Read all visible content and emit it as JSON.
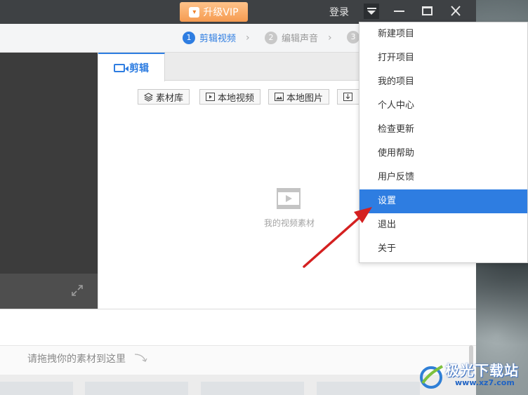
{
  "titlebar": {
    "vip_label": "升级VIP",
    "login_label": "登录"
  },
  "steps": [
    {
      "num": "1",
      "label": "剪辑视频",
      "active": true
    },
    {
      "num": "2",
      "label": "编辑声音",
      "active": false
    },
    {
      "num": "3",
      "label": "",
      "active": false
    }
  ],
  "tabs": {
    "edit_label": "剪辑"
  },
  "media_buttons": {
    "library": "素材库",
    "local_video": "本地视频",
    "local_image": "本地图片"
  },
  "empty_hint": "我的视频素材",
  "timeline": {
    "drop_hint": "请拖拽你的素材到这里"
  },
  "menu": {
    "items": [
      "新建项目",
      "打开项目",
      "我的项目",
      "个人中心",
      "检查更新",
      "使用帮助",
      "用户反馈",
      "设置",
      "退出",
      "关于"
    ],
    "selected_index": 7
  },
  "watermark": {
    "title": "极光下载站",
    "url": "www.xz7.com"
  },
  "colors": {
    "accent": "#2e7de1",
    "titlebar": "#3e4144",
    "vip": "#f59b51",
    "annotation_arrow": "#d42020"
  }
}
